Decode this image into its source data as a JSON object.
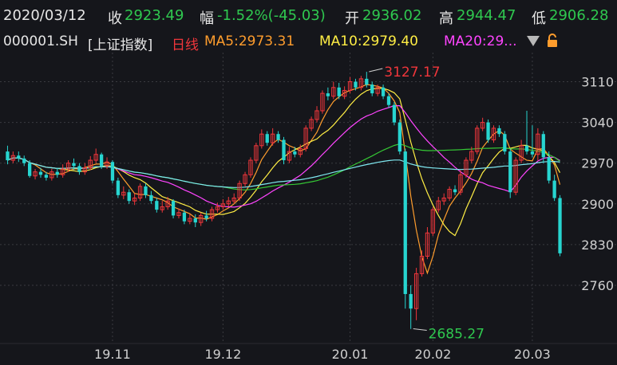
{
  "header": {
    "date": "2020/03/12",
    "close_label": "收",
    "close_value": "2923.49",
    "change_label": "幅",
    "change_value": "-1.52%(-45.03)",
    "open_label": "开",
    "open_value": "2936.02",
    "high_label": "高",
    "high_value": "2944.47",
    "low_label": "低",
    "low_value": "2906.28"
  },
  "subheader": {
    "code": "000001.SH",
    "name": "[上证指数]",
    "period": "日线",
    "ma5": "MA5:2973.31",
    "ma10": "MA10:2979.40",
    "ma20": "MA20:29..."
  },
  "colors": {
    "background": "#15161b",
    "up": "#f0363b",
    "down": "#27d5d0",
    "ma5": "#ff9d2d",
    "ma10": "#ffee44",
    "ma20": "#ff44ff",
    "ma60": "#35c935",
    "ma120": "#7fe8f0",
    "grid": "#3a3b40"
  },
  "icons": {
    "dropdown": "triangle-down-icon",
    "lock": "lock-icon"
  },
  "chart_data": {
    "type": "candlestick",
    "ylim": [
      2660,
      3160
    ],
    "y_ticks": [
      "3110",
      "3040",
      "2970",
      "2900",
      "2830",
      "2760"
    ],
    "y_tick_values": [
      3110,
      3040,
      2970,
      2900,
      2830,
      2760
    ],
    "x_tick_labels": [
      "19.11",
      "19.12",
      "20.01",
      "20.02",
      "20.03"
    ],
    "x_tick_index": [
      19,
      39,
      62,
      77,
      95
    ],
    "annotations": [
      {
        "text": "3127.17",
        "index": 65,
        "value": 3127.17
      },
      {
        "text": "2685.27",
        "index": 73,
        "value": 2685.27
      }
    ],
    "candles": [
      [
        2990,
        2975,
        3000,
        2968
      ],
      [
        2975,
        2983,
        2990,
        2970
      ],
      [
        2983,
        2978,
        2990,
        2972
      ],
      [
        2978,
        2970,
        2983,
        2965
      ],
      [
        2970,
        2948,
        2975,
        2945
      ],
      [
        2948,
        2955,
        2960,
        2942
      ],
      [
        2955,
        2950,
        2962,
        2945
      ],
      [
        2950,
        2945,
        2955,
        2940
      ],
      [
        2945,
        2955,
        2960,
        2940
      ],
      [
        2955,
        2950,
        2962,
        2945
      ],
      [
        2950,
        2960,
        2968,
        2945
      ],
      [
        2960,
        2970,
        2975,
        2955
      ],
      [
        2970,
        2965,
        2978,
        2958
      ],
      [
        2965,
        2955,
        2970,
        2950
      ],
      [
        2955,
        2962,
        2970,
        2950
      ],
      [
        2962,
        2975,
        2982,
        2958
      ],
      [
        2975,
        2985,
        2995,
        2970
      ],
      [
        2985,
        2965,
        2988,
        2960
      ],
      [
        2965,
        2972,
        2980,
        2960
      ],
      [
        2972,
        2940,
        2975,
        2935
      ],
      [
        2940,
        2915,
        2945,
        2910
      ],
      [
        2915,
        2920,
        2930,
        2908
      ],
      [
        2920,
        2905,
        2925,
        2900
      ],
      [
        2905,
        2910,
        2918,
        2898
      ],
      [
        2910,
        2930,
        2935,
        2905
      ],
      [
        2930,
        2915,
        2935,
        2910
      ],
      [
        2915,
        2905,
        2922,
        2900
      ],
      [
        2905,
        2890,
        2910,
        2885
      ],
      [
        2890,
        2895,
        2905,
        2885
      ],
      [
        2895,
        2905,
        2912,
        2890
      ],
      [
        2905,
        2880,
        2908,
        2875
      ],
      [
        2880,
        2885,
        2892,
        2875
      ],
      [
        2885,
        2870,
        2890,
        2865
      ],
      [
        2870,
        2875,
        2882,
        2865
      ],
      [
        2875,
        2868,
        2882,
        2860
      ],
      [
        2868,
        2880,
        2885,
        2862
      ],
      [
        2880,
        2875,
        2888,
        2870
      ],
      [
        2875,
        2890,
        2895,
        2870
      ],
      [
        2890,
        2895,
        2902,
        2885
      ],
      [
        2895,
        2900,
        2908,
        2890
      ],
      [
        2900,
        2905,
        2912,
        2895
      ],
      [
        2905,
        2910,
        2918,
        2900
      ],
      [
        2910,
        2935,
        2940,
        2905
      ],
      [
        2935,
        2950,
        2955,
        2930
      ],
      [
        2950,
        2975,
        2980,
        2945
      ],
      [
        2975,
        3000,
        3005,
        2970
      ],
      [
        3000,
        3020,
        3028,
        2995
      ],
      [
        3020,
        3005,
        3025,
        3000
      ],
      [
        3005,
        3020,
        3030,
        3000
      ],
      [
        3020,
        3010,
        3025,
        3005
      ],
      [
        3010,
        2975,
        3015,
        2968
      ],
      [
        2975,
        2990,
        2998,
        2970
      ],
      [
        2990,
        2985,
        2998,
        2980
      ],
      [
        2985,
        2995,
        3002,
        2980
      ],
      [
        2995,
        3030,
        3035,
        2990
      ],
      [
        3030,
        3045,
        3050,
        3025
      ],
      [
        3045,
        3060,
        3068,
        3040
      ],
      [
        3060,
        3090,
        3095,
        3055
      ],
      [
        3090,
        3085,
        3100,
        3078
      ],
      [
        3085,
        3100,
        3110,
        3080
      ],
      [
        3100,
        3085,
        3108,
        3080
      ],
      [
        3085,
        3095,
        3102,
        3080
      ],
      [
        3095,
        3110,
        3118,
        3090
      ],
      [
        3110,
        3100,
        3115,
        3095
      ],
      [
        3100,
        3115,
        3120,
        3095
      ],
      [
        3115,
        3105,
        3127,
        3100
      ],
      [
        3105,
        3090,
        3110,
        3085
      ],
      [
        3090,
        3100,
        3105,
        3085
      ],
      [
        3100,
        3085,
        3105,
        3080
      ],
      [
        3085,
        3070,
        3090,
        3065
      ],
      [
        3070,
        3040,
        3075,
        3035
      ],
      [
        3040,
        2990,
        3045,
        2985
      ],
      [
        2990,
        2745,
        2995,
        2720
      ],
      [
        2745,
        2720,
        2760,
        2685
      ],
      [
        2720,
        2780,
        2790,
        2700
      ],
      [
        2780,
        2810,
        2820,
        2775
      ],
      [
        2810,
        2850,
        2860,
        2805
      ],
      [
        2850,
        2890,
        2895,
        2845
      ],
      [
        2890,
        2905,
        2912,
        2885
      ],
      [
        2905,
        2910,
        2918,
        2898
      ],
      [
        2910,
        2925,
        2930,
        2905
      ],
      [
        2925,
        2920,
        2932,
        2915
      ],
      [
        2920,
        2950,
        2958,
        2915
      ],
      [
        2950,
        2975,
        2980,
        2945
      ],
      [
        2975,
        2990,
        2998,
        2970
      ],
      [
        2990,
        3030,
        3035,
        2985
      ],
      [
        3030,
        3040,
        3048,
        3025
      ],
      [
        3040,
        3010,
        3045,
        3005
      ],
      [
        3010,
        3030,
        3035,
        3005
      ],
      [
        3030,
        3020,
        3035,
        3015
      ],
      [
        3020,
        2990,
        3025,
        2985
      ],
      [
        2990,
        2920,
        2995,
        2910
      ],
      [
        2920,
        2975,
        2980,
        2915
      ],
      [
        2975,
        3000,
        3010,
        2970
      ],
      [
        3000,
        2990,
        3060,
        2985
      ],
      [
        2990,
        2985,
        3035,
        2980
      ],
      [
        2985,
        3020,
        3030,
        2975
      ],
      [
        3020,
        2980,
        3025,
        2970
      ],
      [
        2980,
        2940,
        2990,
        2935
      ],
      [
        2940,
        2910,
        2950,
        2905
      ],
      [
        2910,
        2815,
        2915,
        2810
      ]
    ]
  }
}
